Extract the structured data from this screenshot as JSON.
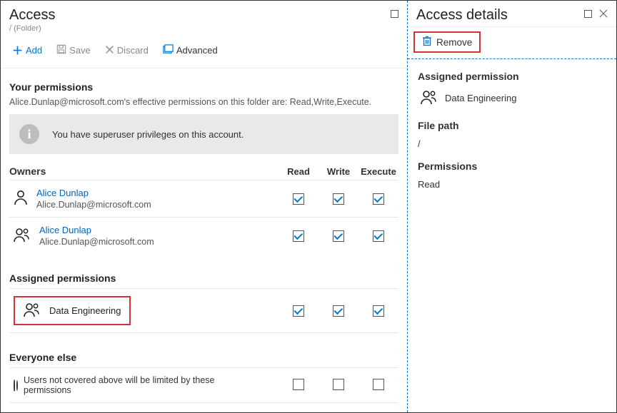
{
  "left": {
    "title": "Access",
    "subtitle": "/ (Folder)",
    "toolbar": {
      "add": "Add",
      "save": "Save",
      "discard": "Discard",
      "advanced": "Advanced"
    },
    "permissions_heading": "Your permissions",
    "permissions_desc": "Alice.Dunlap@microsoft.com's effective permissions on this folder are: Read,Write,Execute.",
    "info_text": "You have superuser privileges on this account.",
    "columns": {
      "read": "Read",
      "write": "Write",
      "execute": "Execute"
    },
    "owners": {
      "heading": "Owners",
      "rows": [
        {
          "name": "Alice Dunlap",
          "email": "Alice.Dunlap@microsoft.com",
          "read": true,
          "write": true,
          "execute": true
        },
        {
          "name": "Alice Dunlap",
          "email": "Alice.Dunlap@microsoft.com",
          "read": true,
          "write": true,
          "execute": true
        }
      ]
    },
    "assigned": {
      "heading": "Assigned permissions",
      "rows": [
        {
          "name": "Data Engineering",
          "read": true,
          "write": true,
          "execute": true
        }
      ]
    },
    "everyone": {
      "heading": "Everyone else",
      "text": "Users not covered above will be limited by these permissions",
      "read": false,
      "write": false,
      "execute": false
    }
  },
  "right": {
    "title": "Access details",
    "remove": "Remove",
    "assigned_heading": "Assigned permission",
    "assigned_item": "Data Engineering",
    "filepath_heading": "File path",
    "filepath_value": "/",
    "permissions_heading": "Permissions",
    "permissions_value": "Read"
  }
}
